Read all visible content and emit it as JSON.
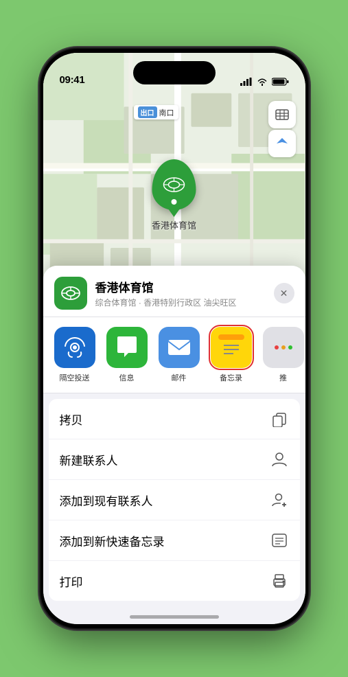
{
  "status": {
    "time": "09:41",
    "location_arrow": "▶"
  },
  "map": {
    "label_tag": "南口",
    "pin_label": "香港体育馆",
    "control_map": "🗺",
    "control_location": "➤"
  },
  "sheet": {
    "venue_name": "香港体育馆",
    "venue_desc": "综合体育馆 · 香港特别行政区 油尖旺区",
    "close_label": "✕"
  },
  "share_items": [
    {
      "id": "airdrop",
      "label": "隔空投送",
      "type": "airdrop"
    },
    {
      "id": "messages",
      "label": "信息",
      "type": "messages"
    },
    {
      "id": "mail",
      "label": "邮件",
      "type": "mail"
    },
    {
      "id": "notes",
      "label": "备忘录",
      "type": "notes",
      "selected": true
    },
    {
      "id": "more",
      "label": "推",
      "type": "more"
    }
  ],
  "actions": [
    {
      "id": "copy",
      "label": "拷贝",
      "icon": "copy"
    },
    {
      "id": "new-contact",
      "label": "新建联系人",
      "icon": "person"
    },
    {
      "id": "add-existing",
      "label": "添加到现有联系人",
      "icon": "person-add"
    },
    {
      "id": "add-notes",
      "label": "添加到新快速备忘录",
      "icon": "note"
    },
    {
      "id": "print",
      "label": "打印",
      "icon": "printer"
    }
  ]
}
